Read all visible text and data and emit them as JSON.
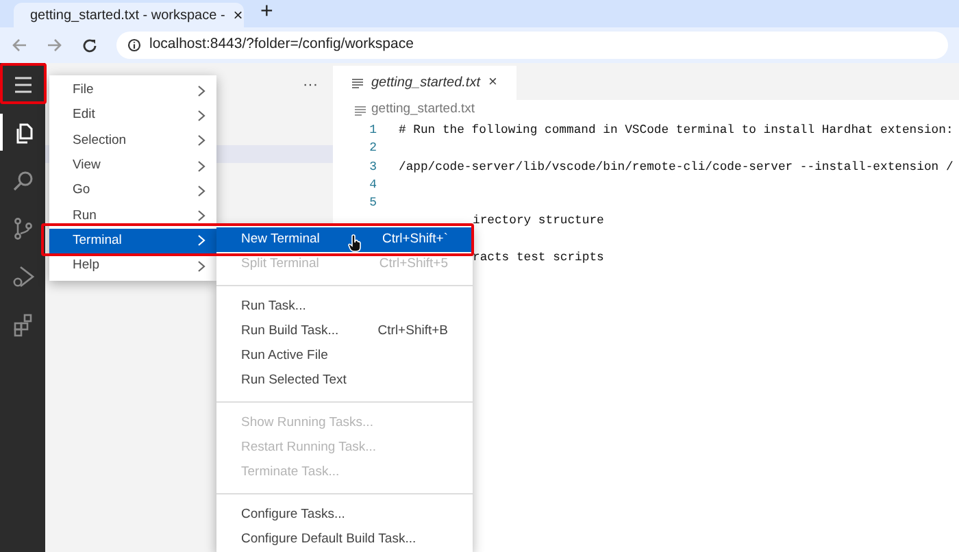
{
  "browser": {
    "tab_title": "getting_started.txt - workspace -",
    "tab_close": "×",
    "new_tab": "+",
    "url": "localhost:8443/?folder=/config/workspace"
  },
  "activity_bar": {
    "items": [
      {
        "kind": "menu",
        "selected": false
      },
      {
        "kind": "explorer",
        "selected": true
      },
      {
        "kind": "search",
        "selected": false
      },
      {
        "kind": "source-control",
        "selected": false
      },
      {
        "kind": "run-debug",
        "selected": false
      },
      {
        "kind": "extensions",
        "selected": false
      }
    ]
  },
  "sidebar": {
    "more": "···"
  },
  "editor": {
    "tab": {
      "label": "getting_started.txt",
      "close": "×"
    },
    "breadcrumb": "getting_started.txt",
    "lines": [
      {
        "number": "1",
        "text": "# Run the following command in VSCode terminal to install Hardhat extension:"
      },
      {
        "number": "2"
      },
      {
        "number": "3",
        "text": "/app/code-server/lib/vscode/bin/remote-cli/code-server --install-extension /"
      },
      {
        "number": "4"
      },
      {
        "number": "5"
      },
      {
        "text": "irectory structure"
      },
      {
        "text": "racts test scripts"
      }
    ]
  },
  "menu": {
    "items": [
      {
        "label": "File",
        "selected": false
      },
      {
        "label": "Edit",
        "selected": false
      },
      {
        "label": "Selection",
        "selected": false
      },
      {
        "label": "View",
        "selected": false
      },
      {
        "label": "Go",
        "selected": false
      },
      {
        "label": "Run",
        "selected": false
      },
      {
        "label": "Terminal",
        "selected": true
      },
      {
        "label": "Help",
        "selected": false
      }
    ]
  },
  "submenu": {
    "groups": [
      [
        {
          "label": "New Terminal",
          "shortcut": "Ctrl+Shift+`",
          "disabled": false,
          "selected": true
        },
        {
          "label": "Split Terminal",
          "shortcut": "Ctrl+Shift+5",
          "disabled": true,
          "selected": false
        }
      ],
      [
        {
          "label": "Run Task...",
          "disabled": false,
          "selected": false
        },
        {
          "label": "Run Build Task...",
          "shortcut": "Ctrl+Shift+B",
          "disabled": false,
          "selected": false
        },
        {
          "label": "Run Active File",
          "disabled": false,
          "selected": false
        },
        {
          "label": "Run Selected Text",
          "disabled": false,
          "selected": false
        }
      ],
      [
        {
          "label": "Show Running Tasks...",
          "disabled": true,
          "selected": false
        },
        {
          "label": "Restart Running Task...",
          "disabled": true,
          "selected": false
        },
        {
          "label": "Terminate Task...",
          "disabled": true,
          "selected": false
        }
      ],
      [
        {
          "label": "Configure Tasks...",
          "disabled": false,
          "selected": false
        },
        {
          "label": "Configure Default Build Task...",
          "disabled": false,
          "selected": false
        }
      ]
    ]
  }
}
